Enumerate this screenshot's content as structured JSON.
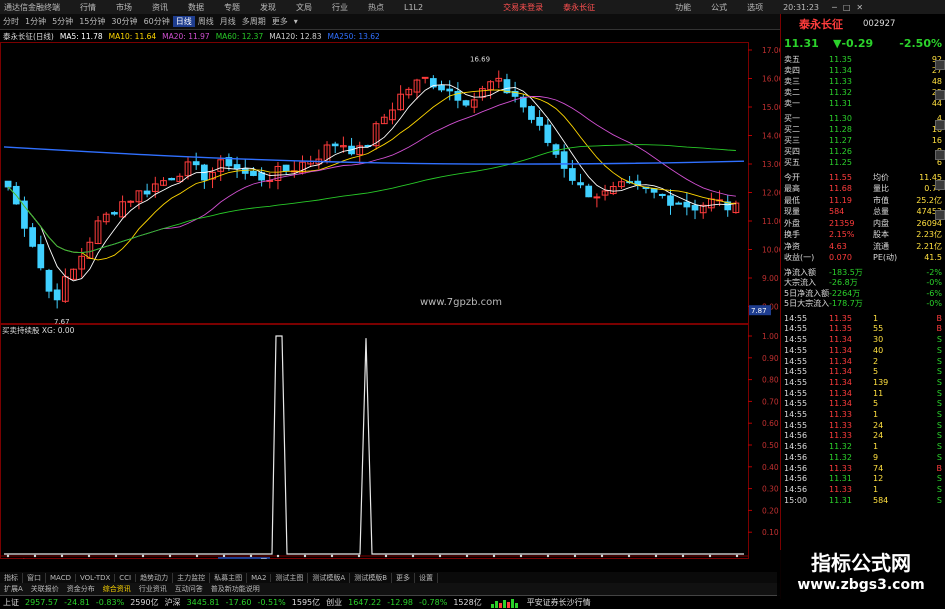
{
  "titlebar": {
    "app": "通达信金融终端",
    "menus": [
      "行情",
      "市场",
      "资讯",
      "数据",
      "专题",
      "发现",
      "文局",
      "行业",
      "热点",
      "L1L2"
    ],
    "center_warn": "交易未登录",
    "center_stock": "泰永长征",
    "right_menus": [
      "功能",
      "公式",
      "选项"
    ],
    "time": "20:31:23"
  },
  "periods": [
    "分时",
    "1分钟",
    "5分钟",
    "15分钟",
    "30分钟",
    "60分钟",
    "日线",
    "周线",
    "月线",
    "多周期",
    "更多"
  ],
  "period_selected": "日线",
  "info": {
    "name": "泰永长征(日线)",
    "ma5": "MA5: 11.78",
    "ma10": "MA10: 11.64",
    "ma20": "MA20: 11.97",
    "ma60": "MA60: 12.37",
    "ma120": "MA120: 12.83",
    "ma250": "MA250: 13.62"
  },
  "price_axis": [
    "17.00",
    "16.00",
    "15.00",
    "14.00",
    "13.00",
    "12.00",
    "11.00",
    "10.00",
    "9.00",
    "8.00"
  ],
  "price_tag": "7.87",
  "max_label": "16.69",
  "min_label": "7.67",
  "watermark_center": "www.7gpzb.com",
  "ind_title": "买卖持续股 XG: 0.00",
  "ind_axis": [
    "1.00",
    "0.90",
    "0.80",
    "0.70",
    "0.60",
    "0.50",
    "0.40",
    "0.30",
    "0.20",
    "0.10"
  ],
  "date_axis": [
    "2024年",
    "3",
    "4",
    "5",
    "6",
    "7"
  ],
  "date_cursor": "2024/03/21四",
  "indicators": [
    "指标",
    "窗口",
    "MACD",
    "VOL-TDX",
    "CCI",
    "趋势动力",
    "主力监控",
    "私募主图",
    "MA2",
    "测试主图",
    "测试模版A",
    "测试模版B",
    "更多",
    "设置"
  ],
  "indicators2": [
    "扩展A",
    "关联报价",
    "资金分布",
    "综合资讯",
    "行业资讯",
    "互动问答",
    "普及新功能说明"
  ],
  "stock": {
    "name": "泰永长征",
    "code": "002927",
    "price": "11.31",
    "change": "▼-0.29",
    "pct": "-2.50%"
  },
  "asks": [
    {
      "l": "卖五",
      "p": "11.35",
      "v": "92"
    },
    {
      "l": "卖四",
      "p": "11.34",
      "v": "27"
    },
    {
      "l": "卖三",
      "p": "11.33",
      "v": "48"
    },
    {
      "l": "卖二",
      "p": "11.32",
      "v": "25"
    },
    {
      "l": "卖一",
      "p": "11.31",
      "v": "44"
    }
  ],
  "bids": [
    {
      "l": "买一",
      "p": "11.30",
      "v": "4"
    },
    {
      "l": "买二",
      "p": "11.28",
      "v": "16"
    },
    {
      "l": "买三",
      "p": "11.27",
      "v": "16"
    },
    {
      "l": "买四",
      "p": "11.26",
      "v": "8"
    },
    {
      "l": "买五",
      "p": "11.25",
      "v": "6"
    }
  ],
  "quote": [
    {
      "a": "今开",
      "b": "11.55",
      "c": "均价",
      "d": "11.45"
    },
    {
      "a": "最高",
      "b": "11.68",
      "c": "量比",
      "d": "0.77"
    },
    {
      "a": "最低",
      "b": "11.19",
      "c": "市值",
      "d": "25.2亿"
    },
    {
      "a": "现量",
      "b": "584",
      "c": "总量",
      "d": "47453"
    },
    {
      "a": "外盘",
      "b": "21359",
      "c": "内盘",
      "d": "26094"
    },
    {
      "a": "换手",
      "b": "2.15%",
      "c": "股本",
      "d": "2.23亿"
    },
    {
      "a": "净资",
      "b": "4.63",
      "c": "流通",
      "d": "2.21亿"
    },
    {
      "a": "收益(一)",
      "b": "0.070",
      "c": "PE(动)",
      "d": "41.5"
    }
  ],
  "flows": [
    {
      "a": "净流入额",
      "b": "-183.5万",
      "c": "-2%"
    },
    {
      "a": "大宗流入",
      "b": "-26.8万",
      "c": "-0%"
    },
    {
      "a": "5日净流入额",
      "b": "-2264万",
      "c": "-6%"
    },
    {
      "a": "5日大宗流入",
      "b": "-178.7万",
      "c": "-0%"
    }
  ],
  "ticks": [
    {
      "t": "14:55",
      "p": "11.35",
      "v": "1",
      "s": "B"
    },
    {
      "t": "14:55",
      "p": "11.35",
      "v": "55",
      "s": "B"
    },
    {
      "t": "14:55",
      "p": "11.34",
      "v": "30",
      "s": "S"
    },
    {
      "t": "14:55",
      "p": "11.34",
      "v": "40",
      "s": "S"
    },
    {
      "t": "14:55",
      "p": "11.34",
      "v": "2",
      "s": "S"
    },
    {
      "t": "14:55",
      "p": "11.34",
      "v": "5",
      "s": "S"
    },
    {
      "t": "14:55",
      "p": "11.34",
      "v": "139",
      "s": "S"
    },
    {
      "t": "14:55",
      "p": "11.34",
      "v": "11",
      "s": "S"
    },
    {
      "t": "14:55",
      "p": "11.34",
      "v": "5",
      "s": "S"
    },
    {
      "t": "14:55",
      "p": "11.33",
      "v": "1",
      "s": "S"
    },
    {
      "t": "14:55",
      "p": "11.33",
      "v": "24",
      "s": "S"
    },
    {
      "t": "14:56",
      "p": "11.33",
      "v": "24",
      "s": "S"
    },
    {
      "t": "14:56",
      "p": "11.32",
      "v": "1",
      "s": "S"
    },
    {
      "t": "14:56",
      "p": "11.32",
      "v": "9",
      "s": "S"
    },
    {
      "t": "14:56",
      "p": "11.33",
      "v": "74",
      "s": "B"
    },
    {
      "t": "14:56",
      "p": "11.31",
      "v": "12",
      "s": "S"
    },
    {
      "t": "14:56",
      "p": "11.33",
      "v": "1",
      "s": "S"
    },
    {
      "t": "15:00",
      "p": "11.31",
      "v": "584",
      "s": "S"
    }
  ],
  "indices": [
    {
      "n": "上证",
      "v": "2957.57",
      "c": "-24.81",
      "p": "-0.83%",
      "a": "2590亿"
    },
    {
      "n": "沪深",
      "v": "3445.81",
      "c": "-17.60",
      "p": "-0.51%",
      "a": "1595亿"
    },
    {
      "n": "创业",
      "v": "1647.22",
      "c": "-12.98",
      "p": "-0.78%",
      "a": "1528亿"
    }
  ],
  "broker": "平安证券长沙行情",
  "wm1": "指标公式网",
  "wm2": "www.zbgs3.com",
  "colors": {
    "up": "#ff3c3c",
    "down": "#2bd22b",
    "ma5": "#ffffff",
    "ma10": "#ffd700",
    "ma20": "#d050d0",
    "ma60": "#28c828",
    "ma120": "#3070ff"
  }
}
